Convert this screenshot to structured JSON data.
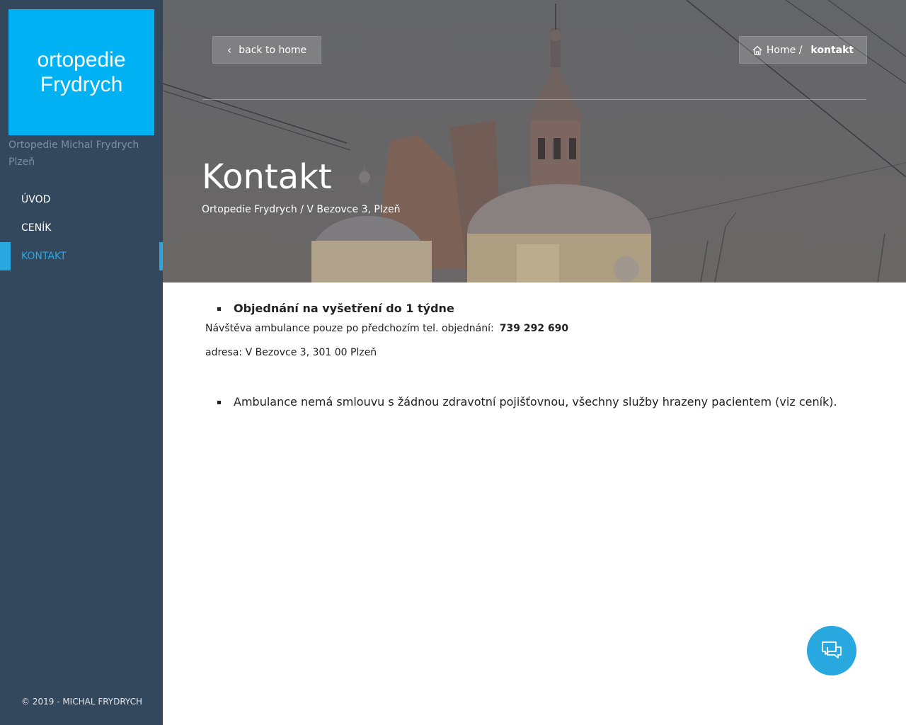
{
  "brand": {
    "logo_line1": "ortopedie",
    "logo_line2": "Frydrych",
    "tagline": "Ortopedie Michal Frydrych Plzeň",
    "logo_color": "#00b2f3"
  },
  "sidebar": {
    "items": [
      {
        "label": "ÚVOD",
        "active": false
      },
      {
        "label": "CENÍK",
        "active": false
      },
      {
        "label": "KONTAKT",
        "active": true
      }
    ],
    "copyright": "© 2019 - MICHAL FRYDRYCH",
    "active_color": "#29a8e0"
  },
  "header": {
    "back_label": "back to home",
    "breadcrumb_home": "Home /",
    "breadcrumb_current": "kontakt",
    "title": "Kontakt",
    "subtitle": "Ortopedie Frydrych / V Bezovce 3, Plzeň"
  },
  "content": {
    "heading": "Objednání na vyšetření do 1 týdne",
    "visit_text": "Návštěva ambulance pouze po předchozím tel. objednání:",
    "phone": "739 292 690",
    "address": "adresa: V Bezovce 3, 301 00 Plzeň",
    "insurance_note": "Ambulance nemá smlouvu s žádnou zdravotní pojišťovnou, všechny služby hrazeny pacientem (viz ceník)."
  },
  "icons": {
    "back": "chevron-left-icon",
    "home": "home-icon",
    "chat": "chat-icon"
  }
}
